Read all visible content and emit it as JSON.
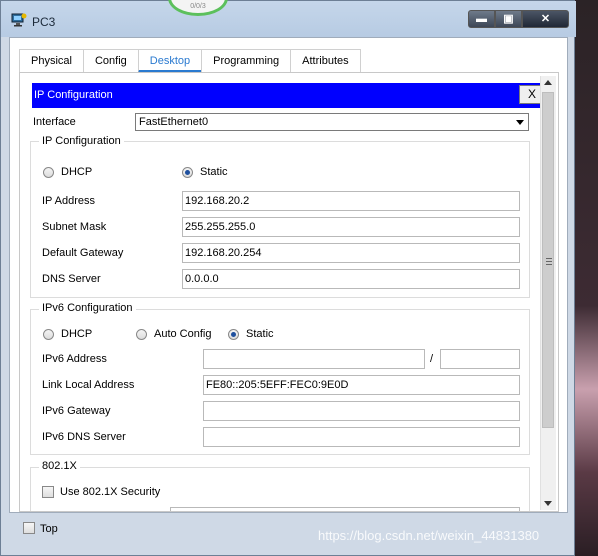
{
  "window": {
    "title": "PC3",
    "minimize_glyph": "▬",
    "maximize_glyph": "▣",
    "close_glyph": "✕"
  },
  "top_badge": {
    "text": "0/0/3"
  },
  "tabs": [
    {
      "label": "Physical",
      "active": false
    },
    {
      "label": "Config",
      "active": false
    },
    {
      "label": "Desktop",
      "active": true
    },
    {
      "label": "Programming",
      "active": false
    },
    {
      "label": "Attributes",
      "active": false
    }
  ],
  "ip_config": {
    "header": "IP Configuration",
    "close_label": "X",
    "interface_label": "Interface",
    "interface_value": "FastEthernet0",
    "ipv4": {
      "group_title": "IP Configuration",
      "dhcp_label": "DHCP",
      "static_label": "Static",
      "selected": "Static",
      "ip_address_label": "IP Address",
      "ip_address_value": "192.168.20.2",
      "subnet_mask_label": "Subnet Mask",
      "subnet_mask_value": "255.255.255.0",
      "default_gateway_label": "Default Gateway",
      "default_gateway_value": "192.168.20.254",
      "dns_server_label": "DNS Server",
      "dns_server_value": "0.0.0.0"
    },
    "ipv6": {
      "group_title": "IPv6 Configuration",
      "dhcp_label": "DHCP",
      "auto_config_label": "Auto Config",
      "static_label": "Static",
      "selected": "Static",
      "ipv6_address_label": "IPv6 Address",
      "ipv6_address_value": "",
      "prefix_separator": "/",
      "prefix_value": "",
      "link_local_label": "Link Local Address",
      "link_local_value": "FE80::205:5EFF:FEC0:9E0D",
      "ipv6_gateway_label": "IPv6 Gateway",
      "ipv6_gateway_value": "",
      "ipv6_dns_label": "IPv6 DNS Server",
      "ipv6_dns_value": ""
    },
    "dot1x": {
      "group_title": "802.1X",
      "use_security_label": "Use 802.1X Security",
      "checked": false
    }
  },
  "footer": {
    "top_label": "Top",
    "top_checked": false
  },
  "watermark": "https://blog.csdn.net/weixin_44831380",
  "colors": {
    "header_blue": "#0000ff",
    "tab_active": "#2a7ad0",
    "radio_dot": "#1e4f9e"
  }
}
